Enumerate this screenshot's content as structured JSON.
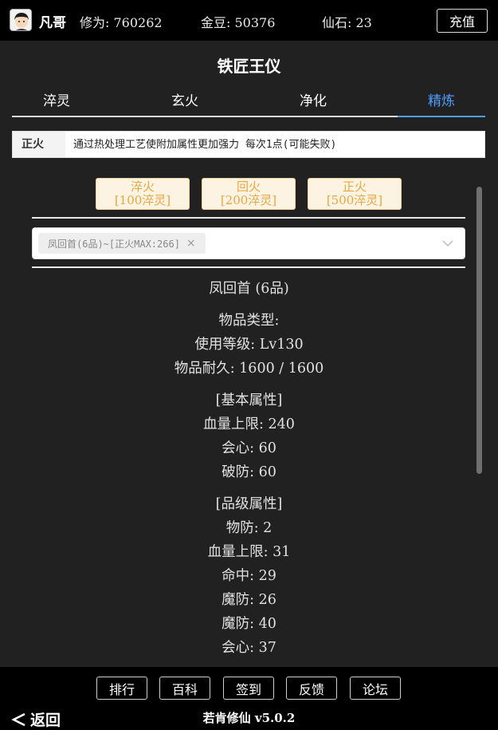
{
  "user": {
    "name": "凡哥",
    "cultivation": "修为: 760262",
    "gold": "金豆: 50376",
    "stones": "仙石: 23",
    "recharge_label": "充值"
  },
  "page": {
    "title": "铁匠王仪",
    "tabs": [
      {
        "label": "淬灵"
      },
      {
        "label": "玄火"
      },
      {
        "label": "净化"
      },
      {
        "label": "精炼"
      }
    ],
    "active_tab": "精炼",
    "accent_color": "#4f9dff"
  },
  "description": {
    "label": "正火",
    "text": "通过热处理工艺使附加属性更加强力 每次1点(可能失败)"
  },
  "actions": [
    {
      "name": "淬火",
      "cost": "[100淬灵]"
    },
    {
      "name": "回火",
      "cost": "[200淬灵]"
    },
    {
      "name": "正火",
      "cost": "[500淬灵]"
    }
  ],
  "select": {
    "tag": "凤回首(6品)~[正火MAX:266]",
    "close": "×"
  },
  "item": {
    "name": "凤回首 (6品)",
    "type": "物品类型:",
    "level": "使用等级: Lv130",
    "durability": "物品耐久: 1600 / 1600",
    "base_header": "[基本属性]",
    "base_attrs": [
      "血量上限: 240",
      "会心: 60",
      "破防: 60"
    ],
    "grade_header": "[品级属性]",
    "grade_attrs": [
      "物防: 2",
      "血量上限: 31",
      "命中: 29",
      "魔防: 26",
      "魔防: 40",
      "会心: 37"
    ]
  },
  "footer": {
    "buttons": [
      "排行",
      "百科",
      "签到",
      "反馈",
      "论坛"
    ],
    "back": "返回",
    "version": "若肯修仙 v5.0.2"
  }
}
